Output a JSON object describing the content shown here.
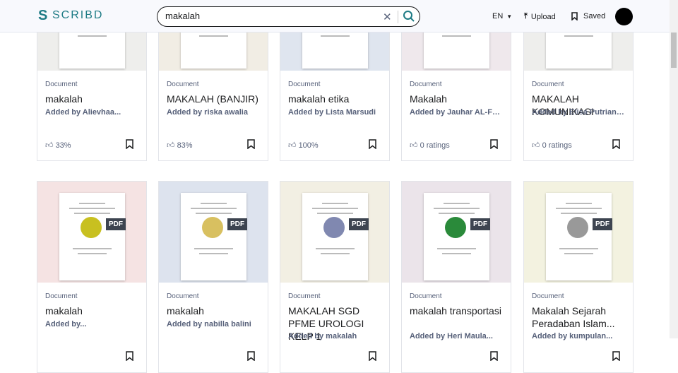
{
  "header": {
    "logo": "SCRIBD",
    "search_value": "makalah",
    "lang": "EN",
    "upload": "Upload",
    "saved": "Saved"
  },
  "colors": {
    "brand": "#1e7b85",
    "text": "#1c1d1f",
    "muted": "#57617a"
  },
  "cards": [
    {
      "kind": "Document",
      "title": "makalah",
      "by": "Added by Alievhaa...",
      "rating": "33%",
      "bg": "#eeeeec",
      "pdf": false
    },
    {
      "kind": "Document",
      "title": "MAKALAH (BANJIR)",
      "by": "Added by riska awalia",
      "rating": "83%",
      "bg": "#f1ede4",
      "pdf": false
    },
    {
      "kind": "Document",
      "title": "makalah etika",
      "by": "Added by Lista Marsudi",
      "rating": "100%",
      "bg": "#dfe5ef",
      "pdf": false
    },
    {
      "kind": "Document",
      "title": "Makalah",
      "by": "Added by Jauhar AL-Farida",
      "rating": "0 ratings",
      "bg": "#efe8ec",
      "pdf": false
    },
    {
      "kind": "Document",
      "title": "MAKALAH KOMUNIKASI",
      "by": "Added by Elisa Putriana...",
      "rating": "0 ratings",
      "bg": "#eeeeec",
      "pdf": false
    },
    {
      "kind": "Document",
      "title": "makalah",
      "by": "Added by...",
      "bg": "#f5e3e3",
      "pdf": "PDF",
      "seal": "#c8c020"
    },
    {
      "kind": "Document",
      "title": "makalah",
      "by": "Added by nabilla balini",
      "bg": "#dde3ee",
      "pdf": "PDF",
      "seal": "#d8c060"
    },
    {
      "kind": "Document",
      "title": "MAKALAH SGD PFME UROLOGI KELP 1",
      "by": "Added by makalah",
      "bg": "#f2efe3",
      "pdf": "PDF",
      "seal": "#8088b0"
    },
    {
      "kind": "Document",
      "title": "makalah transportasi",
      "by": "Added by Heri Maula...",
      "bg": "#ebe4ea",
      "pdf": "PDF",
      "seal": "#2a8a3a"
    },
    {
      "kind": "Document",
      "title": "Makalah Sejarah Peradaban Islam...",
      "by": "Added by kumpulan...",
      "bg": "#f3f2e0",
      "pdf": "PDF",
      "seal": "#999999"
    }
  ]
}
